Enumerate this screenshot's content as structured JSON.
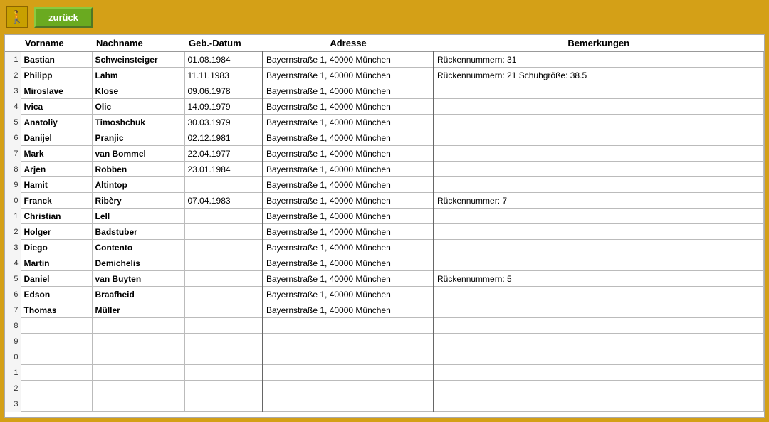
{
  "header": {
    "back_label": "zurück",
    "icon": "🚶"
  },
  "columns": {
    "num": "",
    "vorname": "Vorname",
    "nachname": "Nachname",
    "datum": "Geb.-Datum",
    "adresse": "Adresse",
    "bemerkungen": "Bemerkungen"
  },
  "rows": [
    {
      "num": "1",
      "vorname": "Bastian",
      "nachname": "Schweinsteiger",
      "datum": "01.08.1984",
      "adresse": "Bayernstraße 1, 40000 München",
      "bemerkungen": "Rückennummern: 31"
    },
    {
      "num": "2",
      "vorname": "Philipp",
      "nachname": "Lahm",
      "datum": "11.11.1983",
      "adresse": "Bayernstraße 1, 40000 München",
      "bemerkungen": "Rückennummern: 21 Schuhgröße: 38.5"
    },
    {
      "num": "3",
      "vorname": "Miroslave",
      "nachname": "Klose",
      "datum": "09.06.1978",
      "adresse": "Bayernstraße 1, 40000 München",
      "bemerkungen": ""
    },
    {
      "num": "4",
      "vorname": "Ivica",
      "nachname": "Olic",
      "datum": "14.09.1979",
      "adresse": "Bayernstraße 1, 40000 München",
      "bemerkungen": ""
    },
    {
      "num": "5",
      "vorname": "Anatoliy",
      "nachname": "Timoshchuk",
      "datum": "30.03.1979",
      "adresse": "Bayernstraße 1, 40000 München",
      "bemerkungen": ""
    },
    {
      "num": "6",
      "vorname": "Danijel",
      "nachname": "Pranjic",
      "datum": "02.12.1981",
      "adresse": "Bayernstraße 1, 40000 München",
      "bemerkungen": ""
    },
    {
      "num": "7",
      "vorname": "Mark",
      "nachname": "van Bommel",
      "datum": "22.04.1977",
      "adresse": "Bayernstraße 1, 40000 München",
      "bemerkungen": ""
    },
    {
      "num": "8",
      "vorname": "Arjen",
      "nachname": "Robben",
      "datum": "23.01.1984",
      "adresse": "Bayernstraße 1, 40000 München",
      "bemerkungen": ""
    },
    {
      "num": "9",
      "vorname": "Hamit",
      "nachname": "Altintop",
      "datum": "",
      "adresse": "Bayernstraße 1, 40000 München",
      "bemerkungen": ""
    },
    {
      "num": "0",
      "vorname": "Franck",
      "nachname": "Ribèry",
      "datum": "07.04.1983",
      "adresse": "Bayernstraße 1, 40000 München",
      "bemerkungen": "Rückennummer: 7"
    },
    {
      "num": "1",
      "vorname": "Christian",
      "nachname": "Lell",
      "datum": "",
      "adresse": "Bayernstraße 1, 40000 München",
      "bemerkungen": ""
    },
    {
      "num": "2",
      "vorname": "Holger",
      "nachname": "Badstuber",
      "datum": "",
      "adresse": "Bayernstraße 1, 40000 München",
      "bemerkungen": ""
    },
    {
      "num": "3",
      "vorname": "Diego",
      "nachname": "Contento",
      "datum": "",
      "adresse": "Bayernstraße 1, 40000 München",
      "bemerkungen": ""
    },
    {
      "num": "4",
      "vorname": "Martin",
      "nachname": "Demichelis",
      "datum": "",
      "adresse": "Bayernstraße 1, 40000 München",
      "bemerkungen": ""
    },
    {
      "num": "5",
      "vorname": "Daniel",
      "nachname": "van Buyten",
      "datum": "",
      "adresse": "Bayernstraße 1, 40000 München",
      "bemerkungen": "Rückennummern: 5"
    },
    {
      "num": "6",
      "vorname": "Edson",
      "nachname": "Braafheid",
      "datum": "",
      "adresse": "Bayernstraße 1, 40000 München",
      "bemerkungen": ""
    },
    {
      "num": "7",
      "vorname": "Thomas",
      "nachname": "Müller",
      "datum": "",
      "adresse": "Bayernstraße 1, 40000 München",
      "bemerkungen": ""
    },
    {
      "num": "8",
      "vorname": "",
      "nachname": "",
      "datum": "",
      "adresse": "",
      "bemerkungen": ""
    },
    {
      "num": "9",
      "vorname": "",
      "nachname": "",
      "datum": "",
      "adresse": "",
      "bemerkungen": ""
    },
    {
      "num": "0",
      "vorname": "",
      "nachname": "",
      "datum": "",
      "adresse": "",
      "bemerkungen": ""
    },
    {
      "num": "1",
      "vorname": "",
      "nachname": "",
      "datum": "",
      "adresse": "",
      "bemerkungen": ""
    },
    {
      "num": "2",
      "vorname": "",
      "nachname": "",
      "datum": "",
      "adresse": "",
      "bemerkungen": ""
    },
    {
      "num": "3",
      "vorname": "",
      "nachname": "",
      "datum": "",
      "adresse": "",
      "bemerkungen": ""
    }
  ]
}
